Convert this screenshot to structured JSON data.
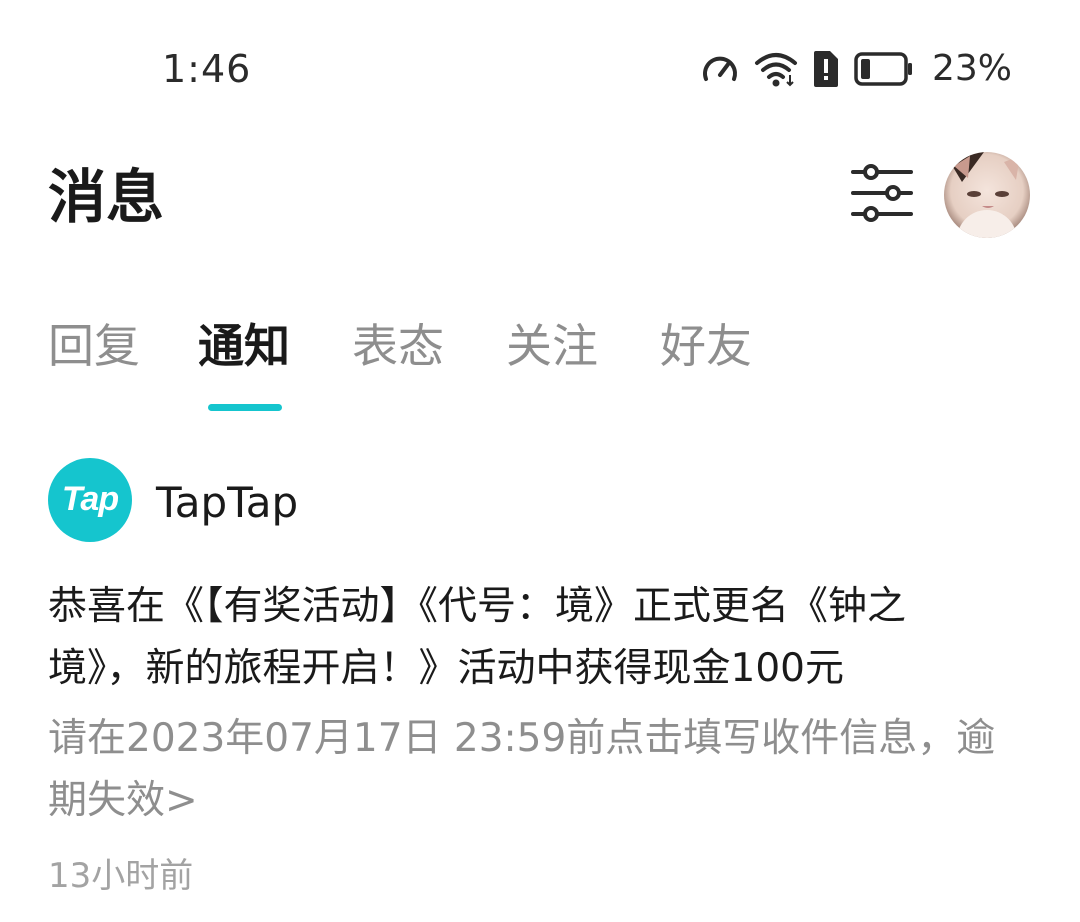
{
  "status_bar": {
    "time": "1:46",
    "battery_percent": "23%",
    "battery_level": 0.23,
    "icons": [
      "speed-icon",
      "wifi-icon",
      "sim-alert-icon",
      "battery-icon"
    ]
  },
  "header": {
    "title": "消息",
    "filter_icon": "sliders-icon",
    "avatar": "user-avatar"
  },
  "tabs": [
    {
      "label": "回复",
      "active": false
    },
    {
      "label": "通知",
      "active": true
    },
    {
      "label": "表态",
      "active": false
    },
    {
      "label": "关注",
      "active": false
    },
    {
      "label": "好友",
      "active": false
    }
  ],
  "colors": {
    "accent": "#15c5ce",
    "text_primary": "#1a1a1a",
    "text_secondary": "#8e8e8e"
  },
  "notification": {
    "sender_logo_text": "Tap",
    "sender_name": "TapTap",
    "body_lines": [
      "恭喜在《【有奖活动】《代号：境》正式更名《钟之",
      "境》，新的旅程开启！》活动中获得现金100元"
    ],
    "action_lines": [
      "请在2023年07月17日 23:59前点击填写收件信息，逾",
      "期失效>"
    ],
    "time_ago": "13小时前"
  }
}
